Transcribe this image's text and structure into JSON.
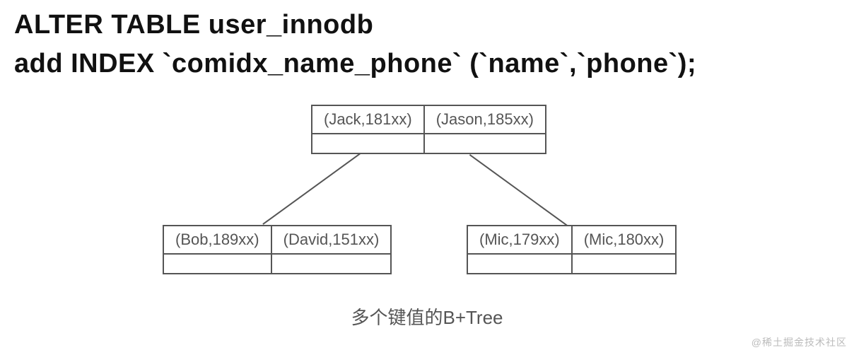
{
  "sql": {
    "line1": "ALTER TABLE user_innodb",
    "line2": "add INDEX `comidx_name_phone` (`name`,`phone`);"
  },
  "tree": {
    "root": {
      "cells": [
        "(Jack,181xx)",
        "(Jason,185xx)"
      ]
    },
    "left": {
      "cells": [
        "(Bob,189xx)",
        "(David,151xx)"
      ]
    },
    "right": {
      "cells": [
        "(Mic,179xx)",
        "(Mic,180xx)"
      ]
    }
  },
  "caption": "多个键值的B+Tree",
  "watermark": "@稀土掘金技术社区"
}
